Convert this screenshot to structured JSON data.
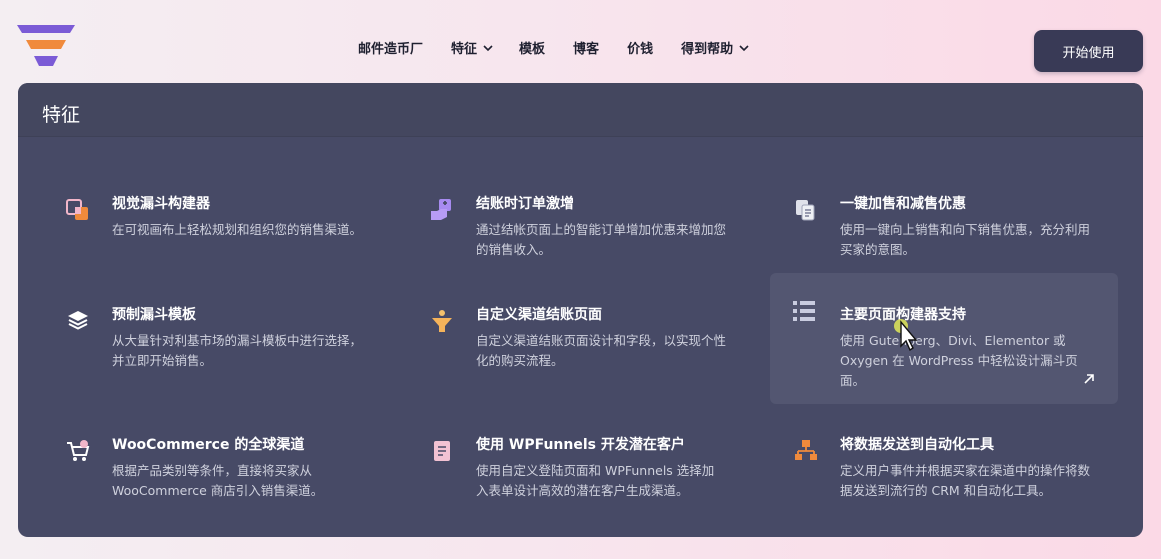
{
  "nav": {
    "items": [
      {
        "label": "邮件造币厂",
        "has_dropdown": false
      },
      {
        "label": "特征",
        "has_dropdown": true
      },
      {
        "label": "模板",
        "has_dropdown": false
      },
      {
        "label": "博客",
        "has_dropdown": false
      },
      {
        "label": "价钱",
        "has_dropdown": false
      },
      {
        "label": "得到帮助",
        "has_dropdown": true
      }
    ],
    "cta_label": "开始使用"
  },
  "panel": {
    "title": "特征",
    "features": [
      {
        "title": "视觉漏斗构建器",
        "desc": "在可视画布上轻松规划和组织您的销售渠道。",
        "icon": "canvas-icon"
      },
      {
        "title": "结账时订单激增",
        "desc": "通过结帐页面上的智能订单增加优惠来增加您的销售收入。",
        "icon": "order-bump-icon"
      },
      {
        "title": "一键加售和减售优惠",
        "desc": "使用一键向上销售和向下销售优惠，充分利用买家的意图。",
        "icon": "upsell-icon"
      },
      {
        "title": "预制漏斗模板",
        "desc": "从大量针对利基市场的漏斗模板中进行选择，并立即开始销售。",
        "icon": "layers-icon"
      },
      {
        "title": "自定义渠道结账页面",
        "desc": "自定义渠道结账页面设计和字段，以实现个性化的购买流程。",
        "icon": "funnel-icon"
      },
      {
        "title": "主要页面构建器支持",
        "desc": "使用 Gutenberg、Divi、Elementor 或 Oxygen 在 WordPress 中轻松设计漏斗页面。",
        "icon": "list-icon"
      },
      {
        "title": "WooCommerce 的全球渠道",
        "desc": "根据产品类别等条件，直接将买家从 WooCommerce 商店引入销售渠道。",
        "icon": "cart-icon"
      },
      {
        "title": "使用 WPFunnels 开发潜在客户",
        "desc": "使用自定义登陆页面和 WPFunnels 选择加入表单设计高效的潜在客户生成渠道。",
        "icon": "document-icon"
      },
      {
        "title": "将数据发送到自动化工具",
        "desc": "定义用户事件并根据买家在渠道中的操作将数据发送到流行的 CRM 和自动化工具。",
        "icon": "automation-icon"
      }
    ]
  },
  "colors": {
    "accent_orange": "#f08a3c",
    "accent_purple": "#7b5bd6",
    "icon_pink": "#f2b6c9",
    "panel_bg": "#474a66",
    "cta_bg": "#393a56"
  }
}
